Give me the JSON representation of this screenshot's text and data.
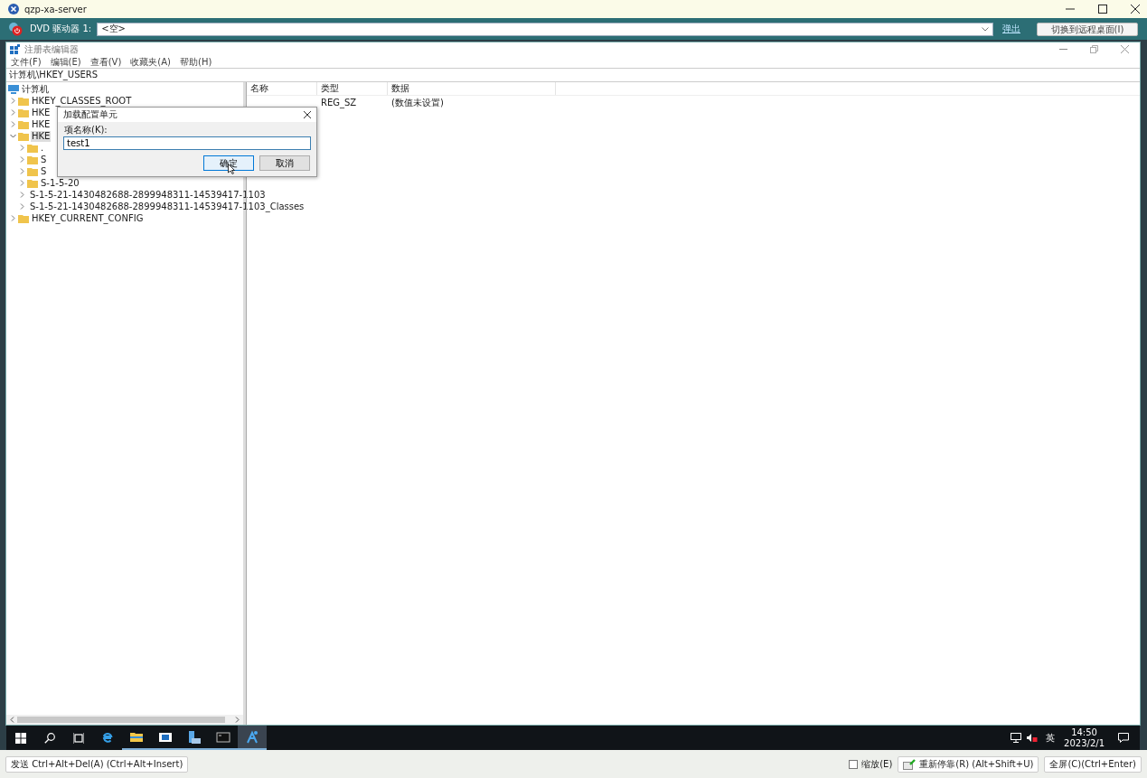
{
  "window": {
    "title": "qzp-xa-server"
  },
  "toolbar": {
    "drive_label": "DVD 驱动器 1:",
    "drive_value": "<空>",
    "eject_link": "弹出",
    "switch_button": "切换到远程桌面(I)"
  },
  "regedit": {
    "title": "注册表编辑器",
    "menu": [
      "文件(F)",
      "编辑(E)",
      "查看(V)",
      "收藏夹(A)",
      "帮助(H)"
    ],
    "address": "计算机\\HKEY_USERS",
    "tree": {
      "label": "计算机",
      "children": [
        {
          "label": "HKEY_CLASSES_ROOT",
          "expanded": false,
          "selected": false
        },
        {
          "label": "HKE",
          "expanded": false,
          "selected": false
        },
        {
          "label": "HKE",
          "expanded": false,
          "selected": false
        },
        {
          "label": "HKE",
          "expanded": true,
          "selected": true,
          "children": [
            {
              "label": ".",
              "expanded": false,
              "selected": false
            },
            {
              "label": "S",
              "expanded": false,
              "selected": false
            },
            {
              "label": "S",
              "expanded": false,
              "selected": false
            },
            {
              "label": "S-1-5-20",
              "expanded": false,
              "selected": false
            },
            {
              "label": "S-1-5-21-1430482688-2899948311-14539417-1103",
              "expanded": false,
              "selected": false
            },
            {
              "label": "S-1-5-21-1430482688-2899948311-14539417-1103_Classes",
              "expanded": false,
              "selected": false
            }
          ]
        },
        {
          "label": "HKEY_CURRENT_CONFIG",
          "expanded": false,
          "selected": false
        }
      ]
    },
    "columns": [
      "名称",
      "类型",
      "数据"
    ],
    "rows": [
      {
        "type": "REG_SZ",
        "data": "(数值未设置)"
      }
    ]
  },
  "dialog": {
    "title": "加载配置单元",
    "label": "项名称(K):",
    "value": "test1",
    "ok_button": "确定",
    "cancel_button": "取消"
  },
  "taskbar": {
    "apps": [
      {
        "kind": "ie",
        "running": false,
        "selected": false
      },
      {
        "kind": "folder",
        "running": true,
        "selected": false
      },
      {
        "kind": "window",
        "running": true,
        "selected": false
      },
      {
        "kind": "server",
        "running": true,
        "selected": false
      },
      {
        "kind": "console",
        "running": true,
        "selected": false
      },
      {
        "kind": "regedit",
        "running": true,
        "selected": true
      }
    ],
    "ime": "英",
    "time": "14:50",
    "date": "2023/2/1"
  },
  "bottom_bar": {
    "send_button": "发送 Ctrl+Alt+Del(A) (Ctrl+Alt+Insert)",
    "scale_checkbox": {
      "label": "缩放(E)",
      "checked": false
    },
    "redock_button": "重新停靠(R) (Alt+Shift+U)",
    "fullscreen_button": "全屏(C)(Ctrl+Enter)"
  }
}
